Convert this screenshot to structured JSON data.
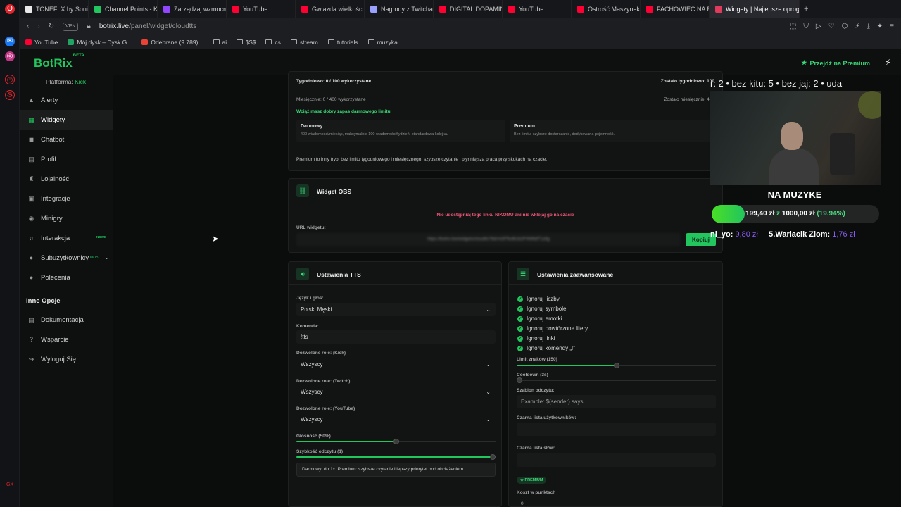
{
  "browser": {
    "tabs": [
      {
        "label": "TONEFLX by SoniX",
        "color": "#e9e9e9"
      },
      {
        "label": "Channel Points - Ki",
        "color": "#22c55e"
      },
      {
        "label": "Zarządzaj wzmocn",
        "color": "#9146ff"
      },
      {
        "label": "YouTube",
        "color": "#ff0033"
      },
      {
        "label": "Gwiazda wielkości",
        "color": "#ff0033"
      },
      {
        "label": "Nagrody z Twitcha",
        "color": "#9aa0ff"
      },
      {
        "label": "DIGITAL DOPAMINE",
        "color": "#ff0033"
      },
      {
        "label": "YouTube",
        "color": "#ff0033"
      },
      {
        "label": "Ostrość Maszynek",
        "color": "#ff0033"
      },
      {
        "label": "FACHOWIEC NA BI",
        "color": "#ff0033"
      },
      {
        "label": "Widgety | Najlepsze oprog",
        "color": "#e03a5c",
        "active": true
      }
    ],
    "url_host": "botrix.live",
    "url_path": "/panel/widget/cloudtts",
    "vpn_label": "VPN",
    "bookmarks": [
      {
        "label": "YouTube",
        "type": "yt"
      },
      {
        "label": "Mój dysk – Dysk G...",
        "type": "drive"
      },
      {
        "label": "Odebrane (9 789)...",
        "type": "gmail"
      },
      {
        "label": "ai",
        "type": "folder"
      },
      {
        "label": "$$$",
        "type": "folder"
      },
      {
        "label": "cs",
        "type": "folder"
      },
      {
        "label": "stream",
        "type": "folder"
      },
      {
        "label": "tutorials",
        "type": "folder"
      },
      {
        "label": "muzyka",
        "type": "folder"
      }
    ]
  },
  "app": {
    "logo": "BotRix",
    "logo_sup": "BETA",
    "premium_link": "Przejdź na Premium",
    "platform_label": "Platforma: ",
    "platform_value": "Kick"
  },
  "sidebar": {
    "items": [
      {
        "label": "Alerty",
        "icon": "alert-icon",
        "glyph": "▲"
      },
      {
        "label": "Widgety",
        "icon": "widgets-icon",
        "glyph": "▦",
        "active": true
      },
      {
        "label": "Chatbot",
        "icon": "chatbot-icon",
        "glyph": "◼"
      },
      {
        "label": "Profil",
        "icon": "profile-icon",
        "glyph": "▤"
      },
      {
        "label": "Lojalność",
        "icon": "trophy-icon",
        "glyph": "♜"
      },
      {
        "label": "Integracje",
        "icon": "integrations-icon",
        "glyph": "▣"
      },
      {
        "label": "Minigry",
        "icon": "gamepad-icon",
        "glyph": "◉"
      },
      {
        "label": "Interakcja",
        "icon": "music-icon",
        "glyph": "♫",
        "badge": "NOWE"
      },
      {
        "label": "Subużytkownicy",
        "icon": "subusers-icon",
        "glyph": "●",
        "badge": "BETA"
      },
      {
        "label": "Polecenia",
        "icon": "referrals-icon",
        "glyph": "●"
      }
    ],
    "section2_title": "Inne Opcje",
    "items2": [
      {
        "label": "Dokumentacja",
        "icon": "docs-icon",
        "glyph": "▤"
      },
      {
        "label": "Wsparcie",
        "icon": "support-icon",
        "glyph": "?"
      },
      {
        "label": "Wyloguj Się",
        "icon": "logout-icon",
        "glyph": "↪"
      }
    ]
  },
  "limits": {
    "weekly": "Tygodniowo: 0 / 100 wykorzystane",
    "weekly_left": "Zostało tygodniowo: 100",
    "monthly": "Miesięcznie: 0 / 400 wykorzystane",
    "monthly_left": "Zostało miesięcznie: 400",
    "status": "Wciąż masz dobry zapas darmowego limitu.",
    "free_title": "Darmowy",
    "free_desc": "400 wiadomości/miesiąc, maksymalnie 100 wiadomości/tydzień, standardowa kolejka.",
    "premium_title": "Premium",
    "premium_desc": "Bez limitu, szybsze dostarczanie, dedykowana pojemność.",
    "note": "Premium to inny tryb: bez limitu tygodniowego i miesięcznego, szybsze czytanie i płynniejsza praca przy skokach na czacie."
  },
  "obs": {
    "title": "Widget OBS",
    "warning": "Nie udostępniaj tego linku NIKOMU ani nie wklejaj go na czacie",
    "url_label": "URL widgetu:",
    "url_value": "https://botrix.live/widgets/cloudtts?bid=k3f7ltu6k1b2F4W8dlT1z8g",
    "copy_label": "Kopiuj"
  },
  "tts": {
    "title": "Ustawienia TTS",
    "voice_label": "Język i głos:",
    "voice_value": "Polski Męski",
    "command_label": "Komenda:",
    "command_value": "!tts",
    "roles_kick_label": "Dozwolone role: (Kick)",
    "roles_kick_value": "Wszyscy",
    "roles_twitch_label": "Dozwolone role: (Twitch)",
    "roles_twitch_value": "Wszyscy",
    "roles_yt_label": "Dozwolone role: (YouTube)",
    "roles_yt_value": "Wszyscy",
    "volume_label": "Głośność (50%)",
    "volume": 0.5,
    "speed_label": "Szybkość odczytu (1)",
    "speed": 1.0,
    "speed_info": "Darmowy: do 1x. Premium: szybsze czytanie i lepszy priorytet pod obciążeniem."
  },
  "advanced": {
    "title": "Ustawienia zaawansowane",
    "checks": [
      "Ignoruj liczby",
      "Ignoruj symbole",
      "Ignoruj emotki",
      "Ignoruj powtórzone litery",
      "Ignoruj linki",
      "Ignoruj komendy „!”"
    ],
    "char_limit_label": "Limit znaków (150)",
    "char_limit": 0.5,
    "cooldown_label": "Cooldown (3s)",
    "cooldown": 0.0,
    "template_label": "Szablon odczytu:",
    "template_placeholder": "Example: $(sender) says:",
    "blacklist_users_label": "Czarna lista użytkowników:",
    "blacklist_words_label": "Czarna lista słów:",
    "premium_pill": "PREMIUM",
    "points_cost_label": "Koszt w punktach",
    "points_cost_value": "0"
  },
  "overlay": {
    "ticker": "r: 2 • bez kitu: 5 • bez jaj: 2 • uda",
    "goal_title": "NA MUZYKE",
    "goal_current": "199,40 zł",
    "goal_sep": " z ",
    "goal_target": "1000,00 zł",
    "goal_pct": "(19.94%)",
    "goal_fraction": 0.1994,
    "donor_left_name": "ni_yo:",
    "donor_left_amt": "9,80 zł",
    "donor_right_name": "5.Wariacik Ziom:",
    "donor_right_amt": "1,76 zł",
    "colors": {
      "accent": "#22c55e",
      "donor_amount": "#8b5cf6"
    }
  }
}
